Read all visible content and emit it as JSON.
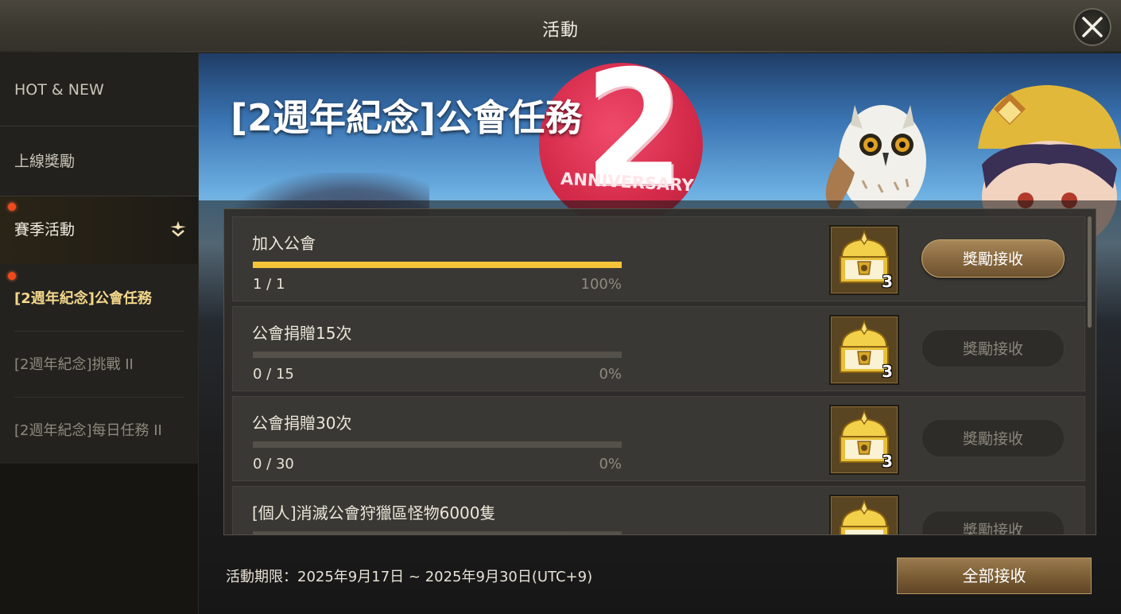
{
  "window": {
    "title": "活動"
  },
  "sidebar": {
    "items": [
      {
        "label": "HOT & NEW"
      },
      {
        "label": "上線獎勵"
      },
      {
        "label": "賽季活動"
      }
    ],
    "subitems": [
      {
        "label": "[2週年紀念]公會任務",
        "selected": true
      },
      {
        "label": "[2週年紀念]挑戰 II"
      },
      {
        "label": "[2週年紀念]每日任務 II"
      }
    ]
  },
  "banner": {
    "title": "[2週年紀念]公會任務",
    "logo_number": "2",
    "logo_text": "ANNIVERSARY"
  },
  "missions": [
    {
      "title": "加入公會",
      "current": 1,
      "target": 1,
      "count_text": "1 / 1",
      "percent_text": "100%",
      "progress": 1.0,
      "reward_icon": "golden-chest-icon",
      "reward_qty": "3",
      "claim_label": "獎勵接收",
      "claimable": true
    },
    {
      "title": "公會捐贈15次",
      "current": 0,
      "target": 15,
      "count_text": "0 / 15",
      "percent_text": "0%",
      "progress": 0.0,
      "reward_icon": "golden-chest-icon",
      "reward_qty": "3",
      "claim_label": "獎勵接收",
      "claimable": false
    },
    {
      "title": "公會捐贈30次",
      "current": 0,
      "target": 30,
      "count_text": "0 / 30",
      "percent_text": "0%",
      "progress": 0.0,
      "reward_icon": "golden-chest-icon",
      "reward_qty": "3",
      "claim_label": "獎勵接收",
      "claimable": false
    },
    {
      "title": "[個人]消滅公會狩獵區怪物6000隻",
      "reward_icon": "golden-chest-icon",
      "claim_label": "獎勵接收",
      "claimable": false
    }
  ],
  "footer": {
    "period": "活動期限：2025年9月17日 ~ 2025年9月30日(UTC+9)",
    "claim_all_label": "全部接收"
  },
  "colors": {
    "progress_fill": "#f6c43a",
    "notification_dot": "#f04a1c",
    "selected_text": "#f3d78c"
  }
}
